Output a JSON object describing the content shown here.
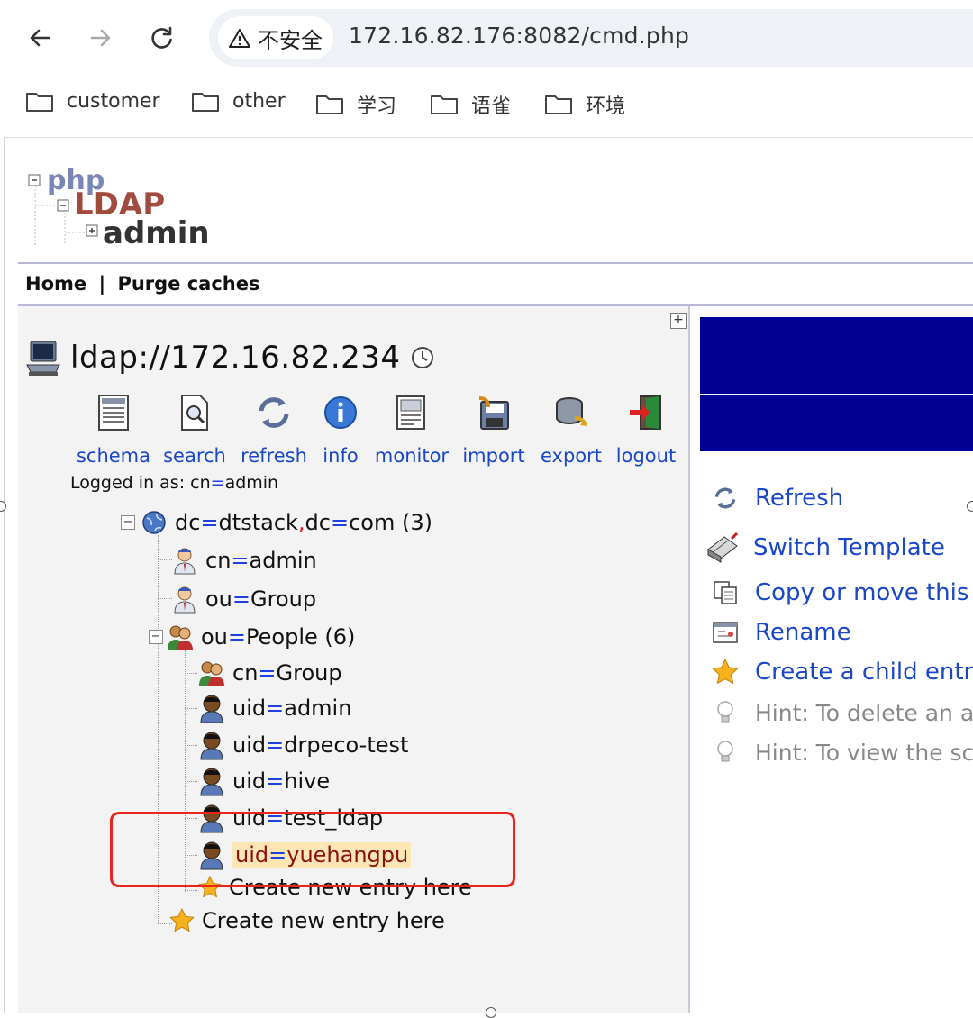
{
  "browser": {
    "security_label": "不安全",
    "url": "172.16.82.176:8082/cmd.php",
    "bookmarks": [
      "customer",
      "other",
      "学习",
      "语雀",
      "环境"
    ]
  },
  "top_menu": {
    "home": "Home",
    "divider": "|",
    "purge": "Purge caches"
  },
  "server": {
    "name": "ldap://172.16.82.234"
  },
  "actions": [
    "schema",
    "search",
    "refresh",
    "info",
    "monitor",
    "import",
    "export",
    "logout"
  ],
  "logged_in": {
    "prefix": "Logged in as: ",
    "attr": "cn",
    "eq": "=",
    "value": "admin"
  },
  "tree": {
    "root": {
      "a1": "dc",
      "v1": "dtstack",
      "comma": ",",
      "a2": "dc",
      "v2": "com",
      "count": " (3)"
    },
    "items": [
      {
        "attr": "cn",
        "value": "admin"
      },
      {
        "attr": "ou",
        "value": "Group"
      },
      {
        "attr": "ou",
        "value": "People",
        "count": " (6)"
      },
      {
        "attr": "cn",
        "value": "Group"
      },
      {
        "attr": "uid",
        "value": "admin"
      },
      {
        "attr": "uid",
        "value": "drpeco-test"
      },
      {
        "attr": "uid",
        "value": "hive"
      },
      {
        "attr": "uid",
        "value": "test_ldap"
      },
      {
        "attr": "uid",
        "value": "yuehangpu"
      }
    ],
    "create_inner": "Create new entry here",
    "create_outer": "Create new entry here"
  },
  "right_actions": {
    "refresh": "Refresh",
    "switch_template": "Switch Template",
    "copy_move": "Copy or move this",
    "rename": "Rename",
    "create_child": "Create a child entr",
    "hint_delete": "Hint: To delete an a",
    "hint_view": "Hint: To view the sc"
  },
  "colors": {
    "accent_link": "#1a47c8",
    "banner": "#000096",
    "highlight_box": "#e8261e"
  }
}
